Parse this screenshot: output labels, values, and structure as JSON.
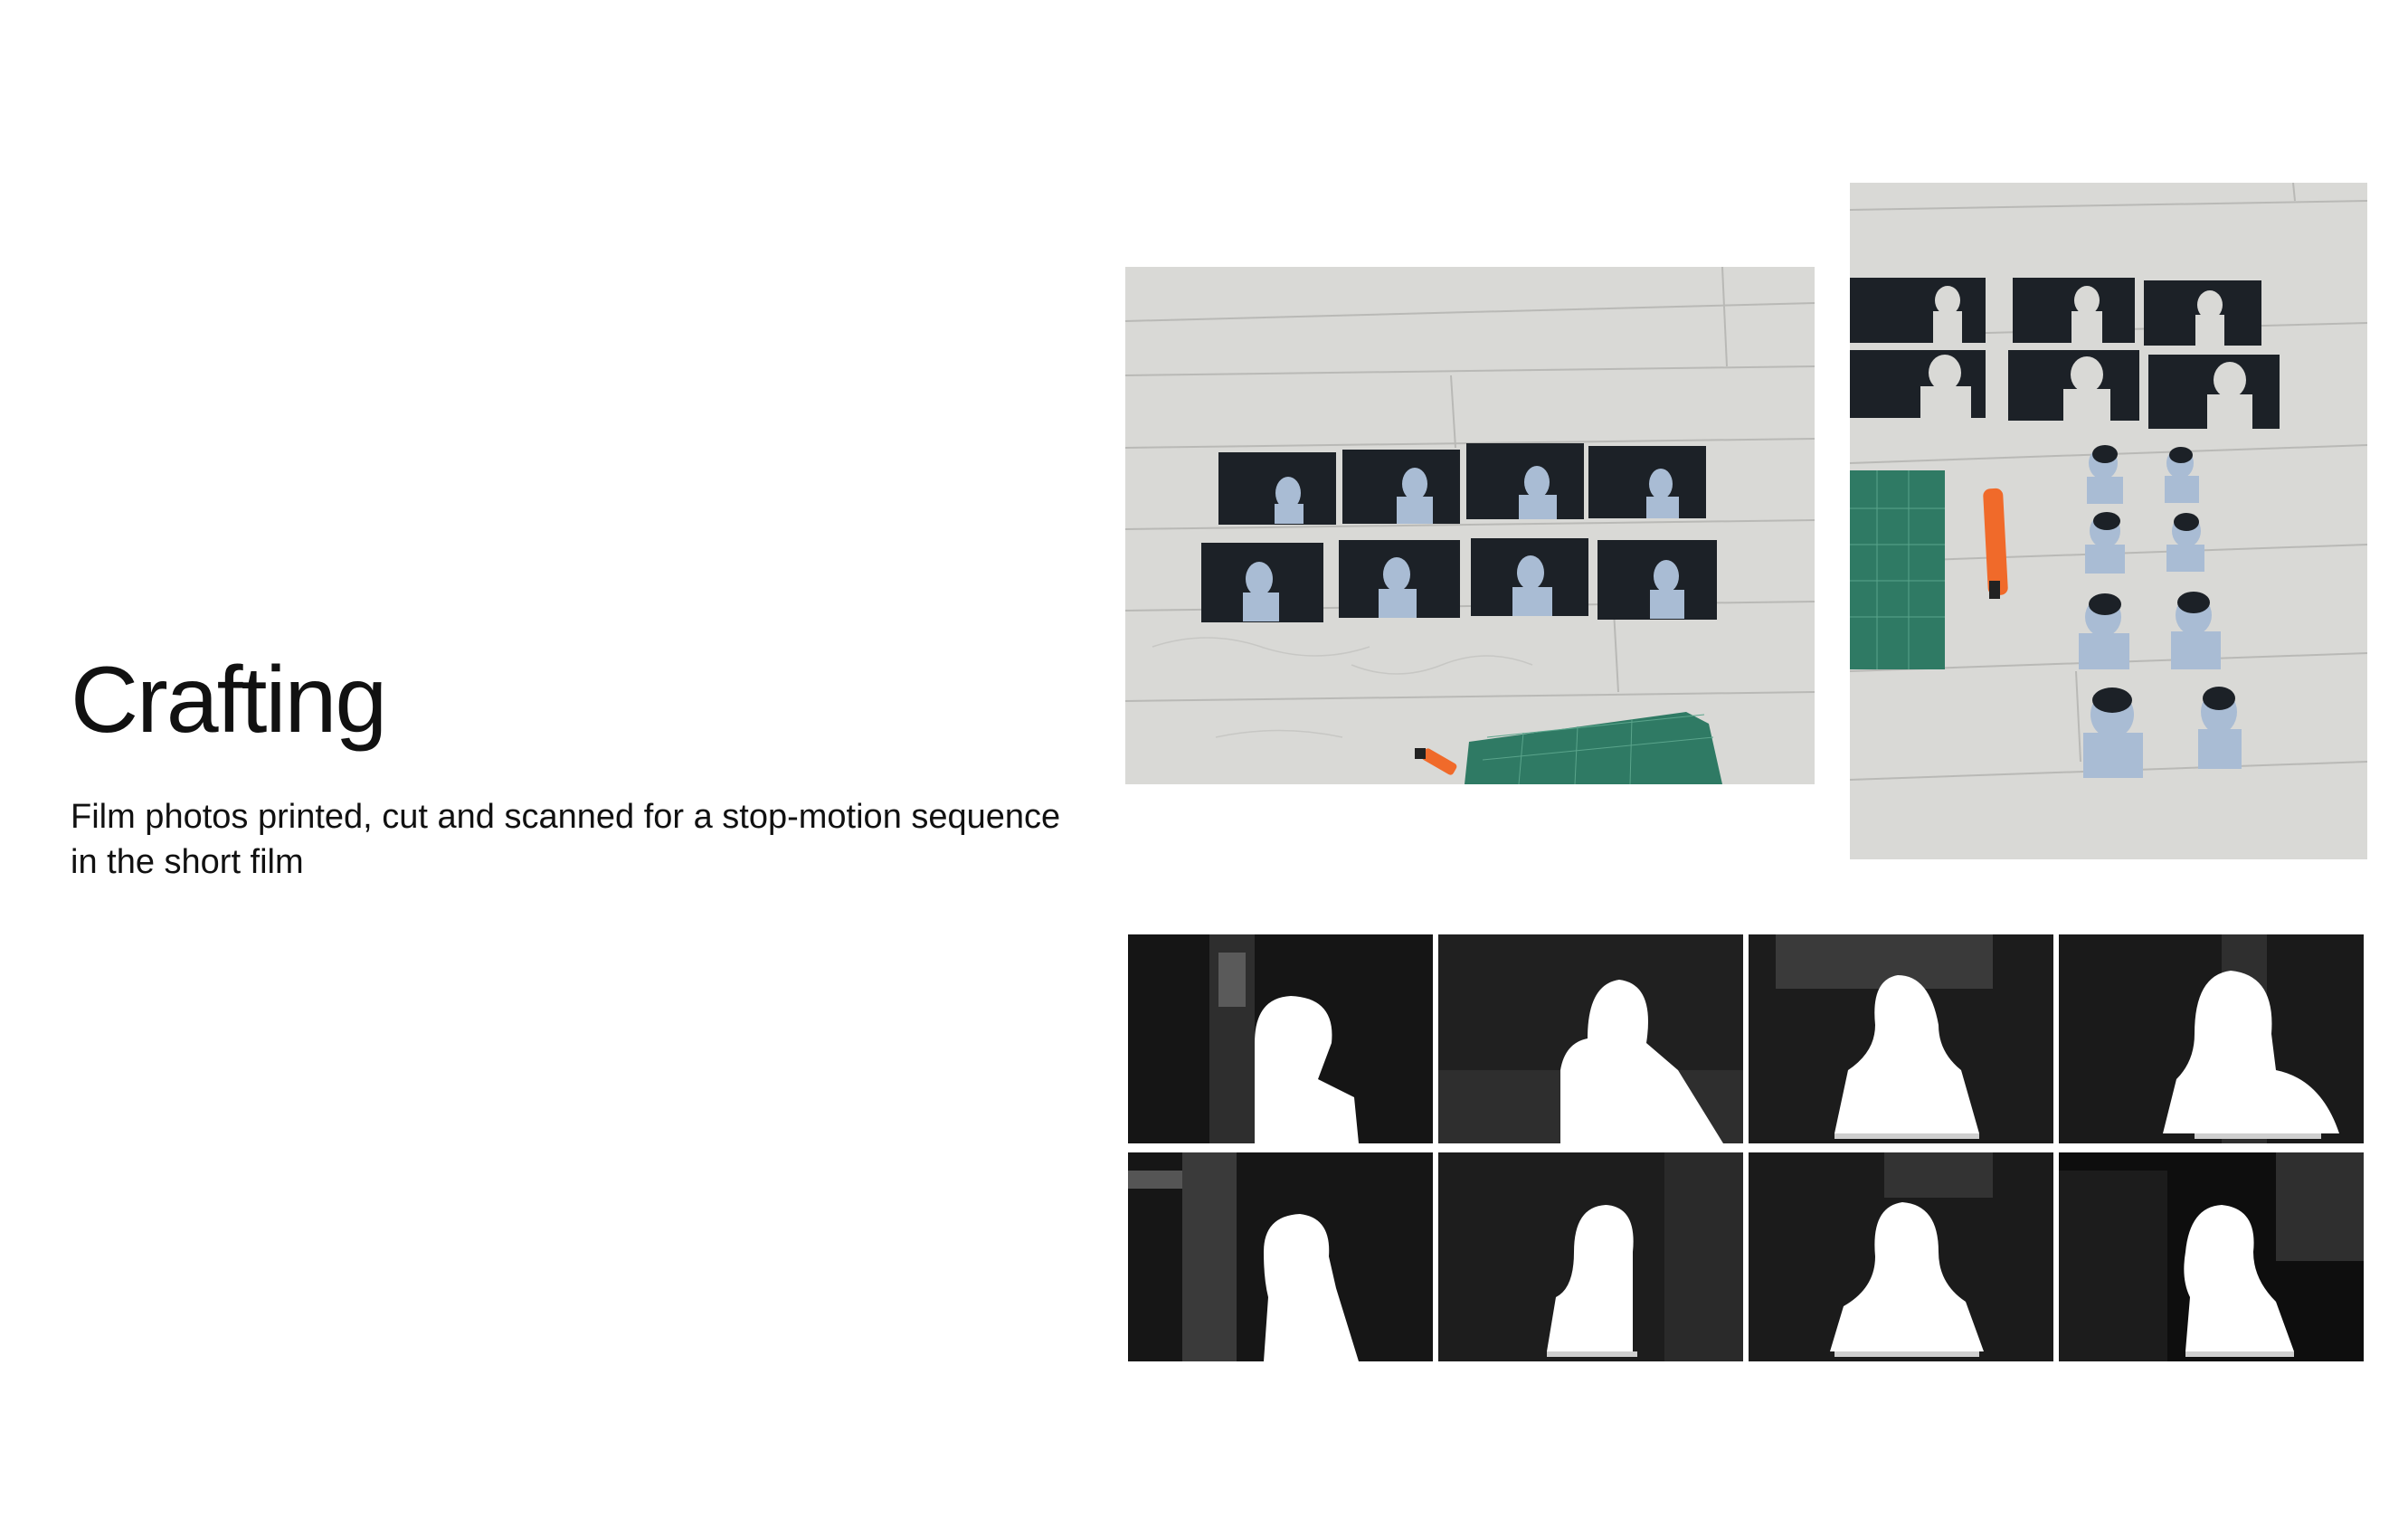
{
  "heading": {
    "title": "Crafting",
    "caption": "Film photos printed, cut and scanned for a stop-motion sequence in the short film"
  },
  "colors": {
    "floor": "#d9d9d6",
    "print_dark": "#1c2127",
    "print_tint": "#a9bcd4",
    "cutting_mat": "#2f7a64",
    "knife": "#f06a2a",
    "silhouette": "#ffffff"
  },
  "images": [
    {
      "name": "photo-floor-prints",
      "alt": "Eight printed film photos laid out on a wooden floor next to a cutting mat and a craft knife"
    },
    {
      "name": "photo-cutouts",
      "alt": "Printed photos with figures cut out, the cut-out figures arranged beside them with a cutting mat and craft knife"
    },
    {
      "name": "scanned-frames",
      "alt": "Eight scanned black-and-white frames with white silhouette cut-outs"
    }
  ]
}
